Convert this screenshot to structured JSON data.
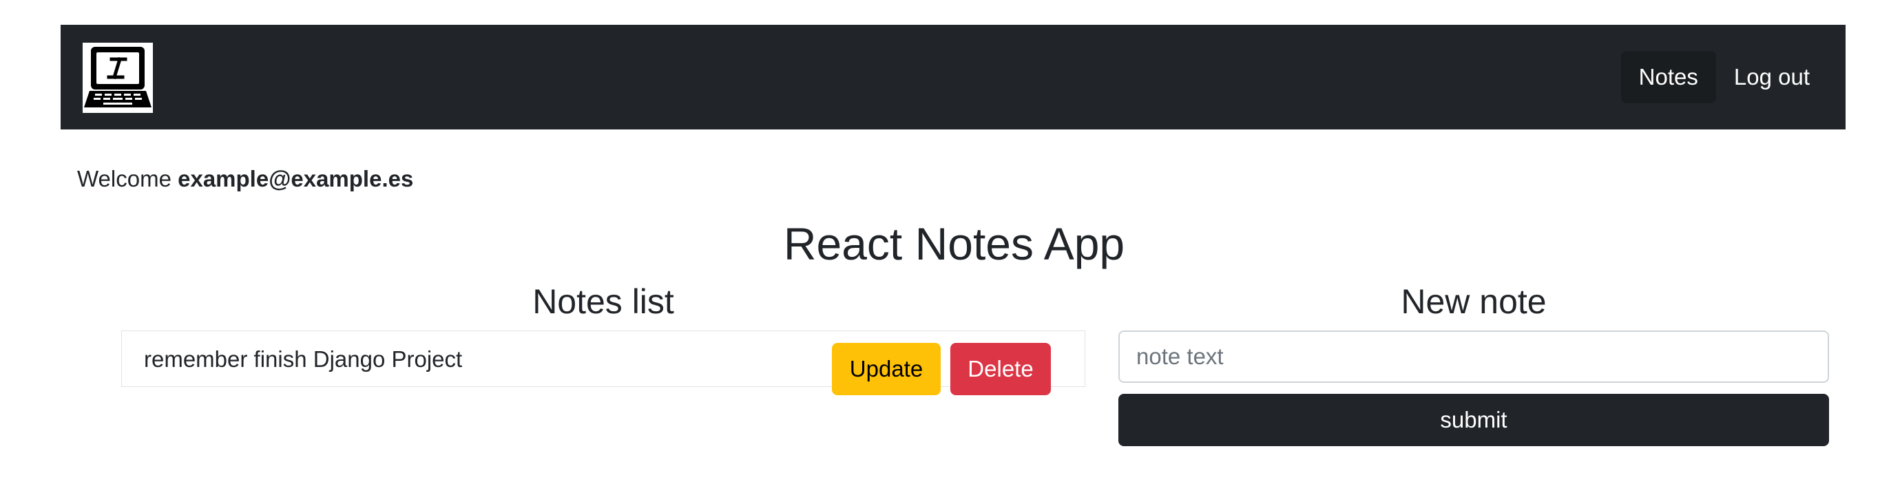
{
  "navbar": {
    "logo_icon": "laptop-logo-icon",
    "links": [
      {
        "label": "Notes",
        "active": true
      },
      {
        "label": "Log out",
        "active": false
      }
    ]
  },
  "welcome": {
    "prefix": "Welcome",
    "user_email": "example@example.es"
  },
  "app_title": "React Notes App",
  "notes_list": {
    "title": "Notes list",
    "items": [
      {
        "text": "remember finish Django Project",
        "update_label": "Update",
        "delete_label": "Delete"
      }
    ]
  },
  "new_note": {
    "title": "New note",
    "input_placeholder": "note text",
    "input_value": "",
    "submit_label": "submit"
  },
  "colors": {
    "navbar_bg": "#212529",
    "update_btn": "#ffc107",
    "delete_btn": "#dc3545",
    "submit_btn": "#212529"
  }
}
